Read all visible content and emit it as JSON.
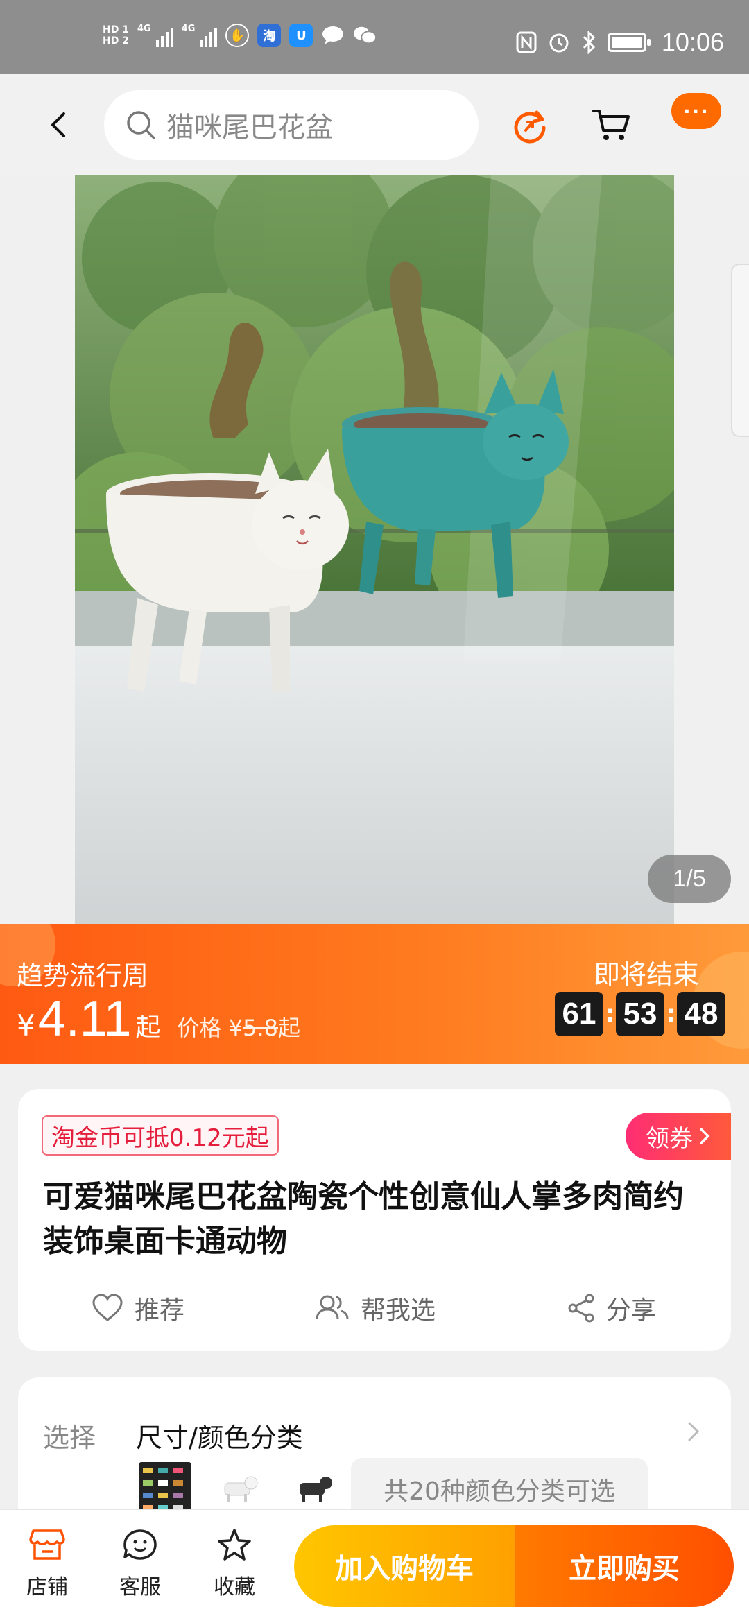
{
  "status_bar": {
    "hd1": "HD 1",
    "hd2": "HD 2",
    "net1": "4G",
    "net2": "4G",
    "time": "10:06"
  },
  "nav": {
    "search_text": "猫咪尾巴花盆",
    "more_label": "···"
  },
  "gallery": {
    "counter": "1/5"
  },
  "promo": {
    "event": "趋势流行周",
    "currency": "¥",
    "price": "4.11",
    "price_suffix": "起",
    "orig_label": "价格",
    "orig_currency": "¥",
    "orig_price": "5.8",
    "orig_suffix": "起",
    "ending": "即将结束",
    "timer": {
      "h": "61",
      "m": "53",
      "s": "48"
    }
  },
  "product": {
    "coin_badge": "淘金币可抵0.12元起",
    "coupon": "领券",
    "title": "可爱猫咪尾巴花盆陶瓷个性创意仙人掌多肉简约装饰桌面卡通动物",
    "actions": {
      "recommend": "推荐",
      "help_choose": "帮我选",
      "share": "分享"
    }
  },
  "select": {
    "label": "选择",
    "value": "尺寸/颜色分类",
    "more_colors": "共20种颜色分类可选"
  },
  "bottom": {
    "shop": "店铺",
    "service": "客服",
    "favorite": "收藏",
    "add_cart": "加入购物车",
    "buy_now": "立即购买"
  },
  "colors": {
    "accent": "#ff5000",
    "promo_start": "#ff5a12",
    "coupon_pink": "#ff2d74",
    "cart_yellow": "#ffb300"
  }
}
